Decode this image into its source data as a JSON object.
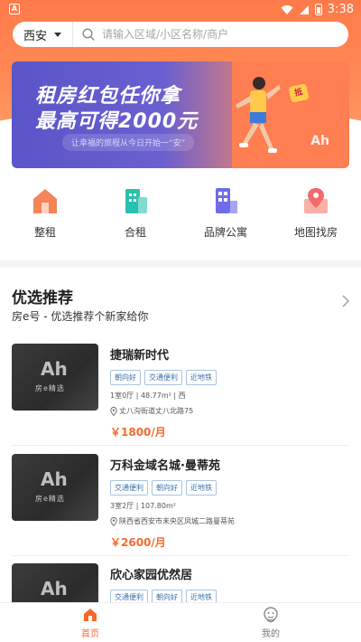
{
  "status_bar": {
    "time": "3:38",
    "left_icon": "A"
  },
  "search": {
    "city": "西安",
    "placeholder": "请输入区域/小区名称/商户"
  },
  "banner": {
    "line1": "租房红包任你拿",
    "line2": "最高可得2000元",
    "subtitle": "让幸福的旅程从今日开始一“安”",
    "badge": "抵",
    "logo": "Ah"
  },
  "categories": [
    {
      "label": "整租",
      "icon": "house-icon",
      "color": "#f5845a"
    },
    {
      "label": "合租",
      "icon": "building-icon",
      "color": "#2bbfae"
    },
    {
      "label": "品牌公寓",
      "icon": "apartment-icon",
      "color": "#6e6ce8"
    },
    {
      "label": "地图找房",
      "icon": "map-pin-icon",
      "color": "#f26a6a"
    }
  ],
  "recommend": {
    "title": "优选推荐",
    "subtitle": "房e号 - 优选推荐个新家给你"
  },
  "listings": [
    {
      "title": "捷瑞新时代",
      "tags": [
        "朝向好",
        "交通便利",
        "近地铁"
      ],
      "meta": "1室0厅 | 48.77m² | 西",
      "address": "丈八沟街道丈八北路75",
      "price": "￥1800/月",
      "thumb_logo": "Ah",
      "thumb_text": "房e精选"
    },
    {
      "title": "万科金域名城·曼蒂苑",
      "tags": [
        "交通便利",
        "朝向好",
        "近地铁"
      ],
      "meta": "3室2厅 | 107.80m²",
      "address": "陕西省西安市未央区凤城二路曼蒂苑",
      "price": "￥2600/月",
      "thumb_logo": "Ah",
      "thumb_text": "房e精选"
    },
    {
      "title": "欣心家园优然居",
      "tags": [
        "交通便利",
        "朝向好",
        "近地铁"
      ],
      "meta": "",
      "address": "",
      "price": "",
      "thumb_logo": "Ah",
      "thumb_text": ""
    }
  ],
  "bottom_nav": [
    {
      "label": "首页",
      "icon": "home-icon",
      "active": true
    },
    {
      "label": "我的",
      "icon": "profile-icon",
      "active": false
    }
  ],
  "colors": {
    "accent": "#f66a2c",
    "header": "#ff7a4a",
    "tag_blue": "#3b6ea8"
  }
}
